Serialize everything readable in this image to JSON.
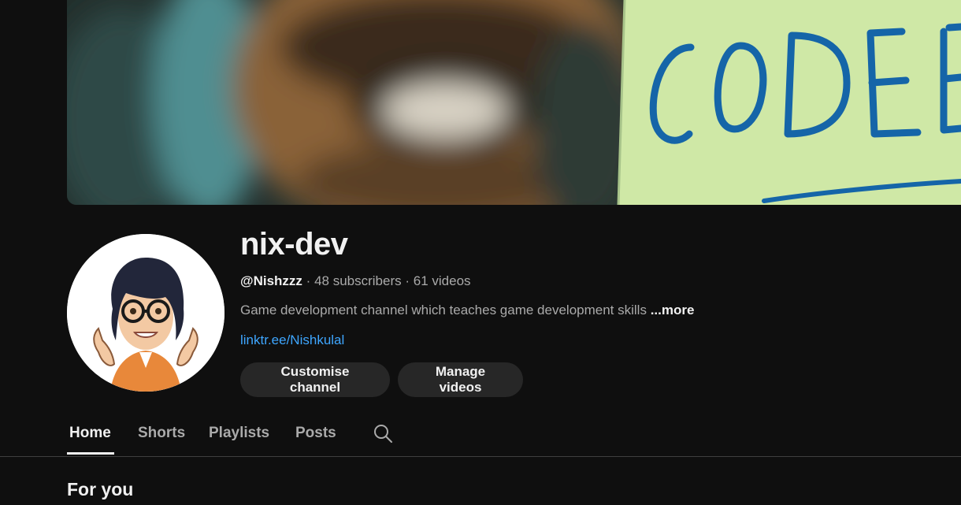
{
  "channel": {
    "name": "nix-dev",
    "handle": "@Nishzzz",
    "subscribers": "48 subscribers",
    "videos": "61 videos",
    "separator": "·",
    "description": "Game development channel which teaches game development skills",
    "more_label": "...more",
    "link": "linktr.ee/Nishkulal",
    "banner_text": "CODE"
  },
  "actions": {
    "customise_label": "Customise channel",
    "manage_label": "Manage videos"
  },
  "tabs": [
    {
      "label": "Home",
      "active": true
    },
    {
      "label": "Shorts",
      "active": false
    },
    {
      "label": "Playlists",
      "active": false
    },
    {
      "label": "Posts",
      "active": false
    }
  ],
  "icons": {
    "search": "search-icon"
  },
  "sections": {
    "for_you": "For you"
  },
  "colors": {
    "background": "#0f0f0f",
    "link": "#3ea6ff",
    "button_bg": "#272727",
    "sticky_note": "#cfe8a6",
    "code_ink": "#1565a8"
  }
}
